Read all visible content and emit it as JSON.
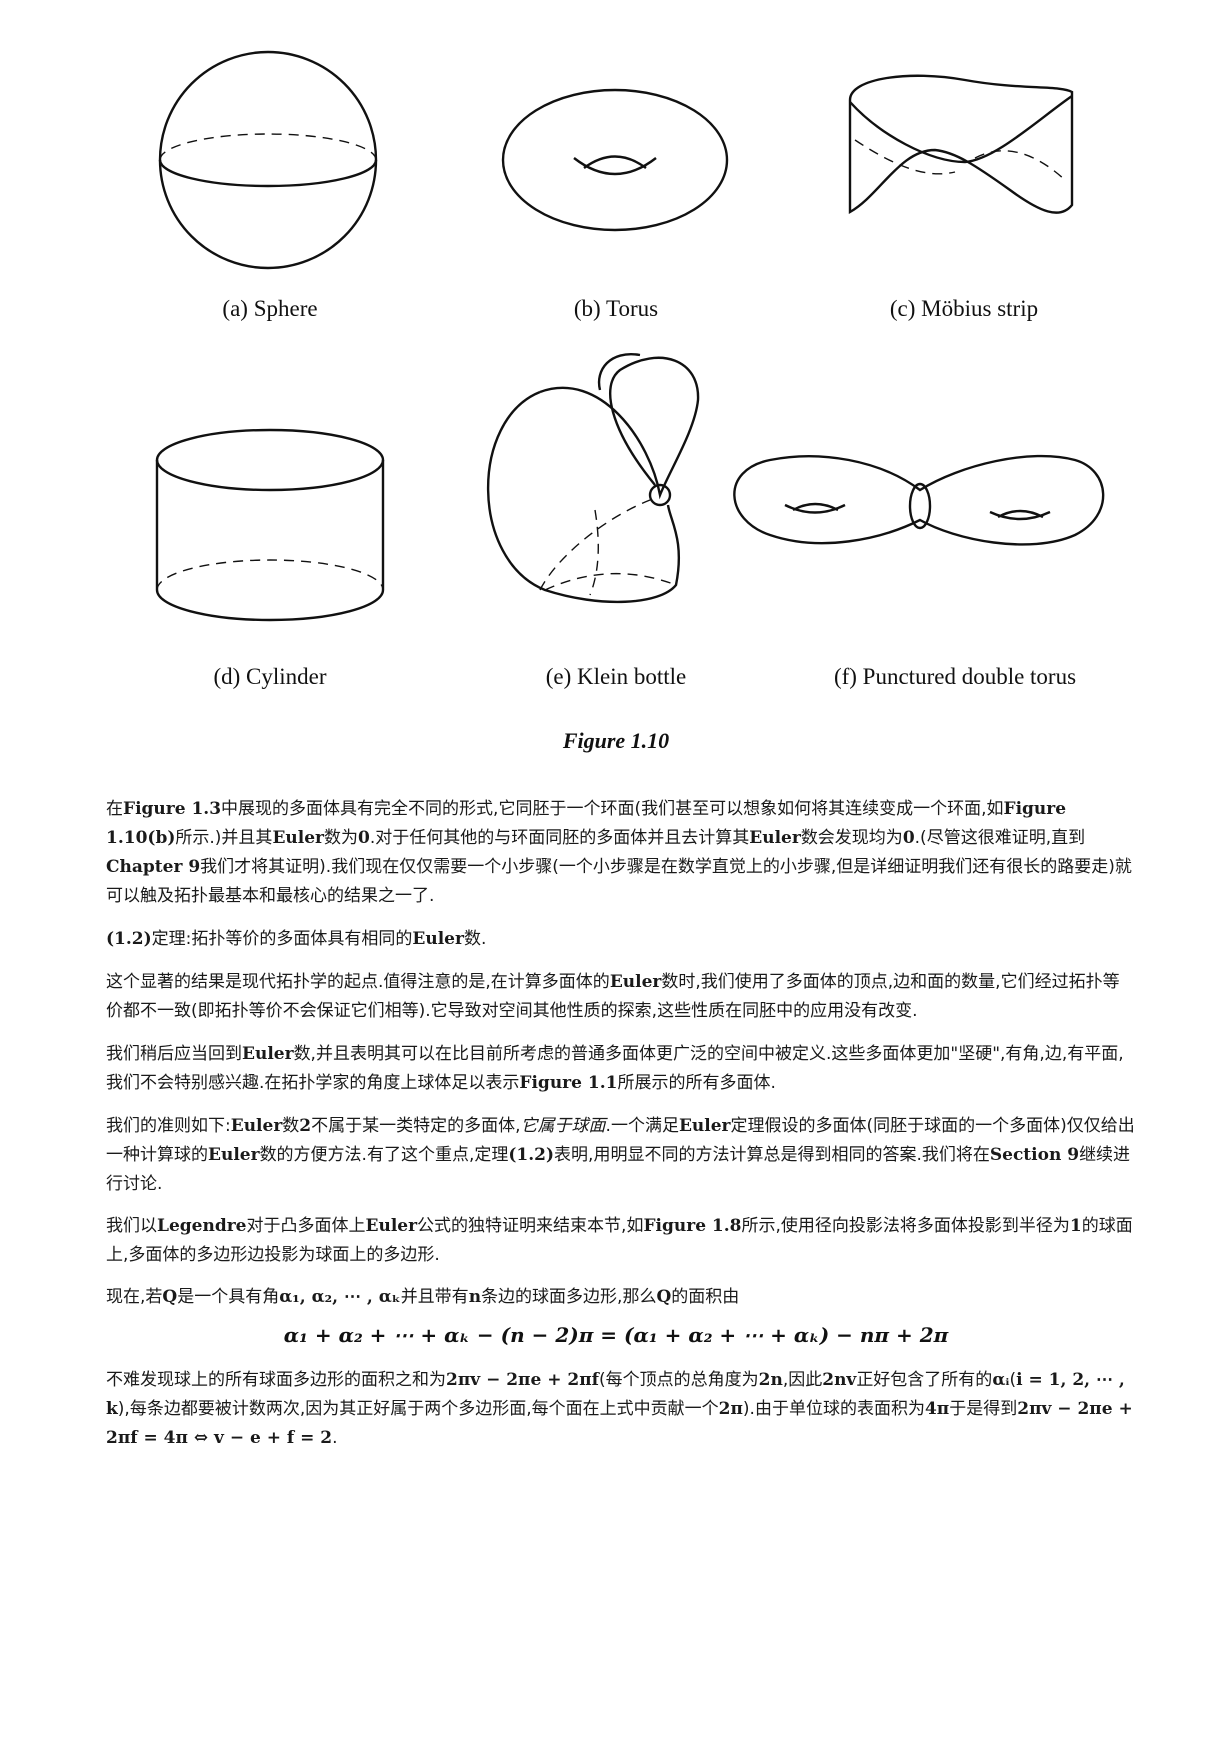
{
  "figure": {
    "captions": {
      "a": "(a) Sphere",
      "b": "(b) Torus",
      "c": "(c) Möbius strip",
      "d": "(d) Cylinder",
      "e": "(e) Klein bottle",
      "f": "(f) Punctured double torus"
    },
    "title": "Figure 1.10"
  },
  "paragraphs": {
    "p1": {
      "a": "在",
      "b": "Figure 1.3",
      "c": "中展现的多面体具有完全不同的形式,它同胚于一个环面(我们甚至可以想象如何将其连续变成一个环面,如",
      "d": "Figure 1.10(b)",
      "e": "所示.)并且其",
      "f": "Euler",
      "g": "数为",
      "h": "0",
      "i": ".对于任何其他的与环面同胚的多面体并且去计算其",
      "j": "Euler",
      "k": "数会发现均为",
      "l": "0",
      "m": ".(尽管这很难证明,直到",
      "n": "Chapter 9",
      "o": "我们才将其证明).我们现在仅仅需要一个小步骤(一个小步骤是在数学直觉上的小步骤,但是详细证明我们还有很长的路要走)就可以触及拓扑最基本和最核心的结果之一了."
    },
    "p2": {
      "a": "(1.2)",
      "b": "定理:拓扑等价的多面体具有相同的",
      "c": "Euler",
      "d": "数."
    },
    "p3": {
      "a": "这个显著的结果是现代拓扑学的起点.值得注意的是,在计算多面体的",
      "b": "Euler",
      "c": "数时,我们使用了多面体的顶点,边和面的数量,它们经过拓扑等价都不一致(即拓扑等价不会保证它们相等).它导致对空间其他性质的探索,这些性质在同胚中的应用没有改变."
    },
    "p4": {
      "a": "我们稍后应当回到",
      "b": "Euler",
      "c": "数,并且表明其可以在比目前所考虑的普通多面体更广泛的空间中被定义.这些多面体更加\"坚硬\",有角,边,有平面,我们不会特别感兴趣.在拓扑学家的角度上球体足以表示",
      "d": "Figure 1.1",
      "e": "所展示的所有多面体."
    },
    "p5": {
      "a": "我们的准则如下:",
      "b": "Euler",
      "c": "数",
      "d": "2",
      "e": "不属于某一类特定的多面体,",
      "f": "它属于球面",
      "g": ".一个满足",
      "h": "Euler",
      "i": "定理假设的多面体(同胚于球面的一个多面体)仅仅给出一种计算球的",
      "j": "Euler",
      "k": "数的方便方法.有了这个重点,定理",
      "l": "(1.2)",
      "m": "表明,用明显不同的方法计算总是得到相同的答案.我们将在",
      "n": "Section 9",
      "o": "继续进行讨论."
    },
    "p6": {
      "a": "我们以",
      "b": "Legendre",
      "c": "对于凸多面体上",
      "d": "Euler",
      "e": "公式的独特证明来结束本节,如",
      "f": "Figure 1.8",
      "g": "所示,使用径向投影法将多面体投影到半径为",
      "h": "1",
      "i": "的球面上,多面体的多边形边投影为球面上的多边形."
    },
    "p7": {
      "a": "现在,若",
      "b": "Q",
      "c": "是一个具有角",
      "d": "α₁, α₂, ⋯ , αₖ",
      "e": "并且带有",
      "f": "n",
      "g": "条边的球面多边形,那么",
      "h": "Q",
      "i": "的面积由"
    },
    "equation": "α₁ + α₂ + ⋯ + αₖ − (n − 2)π = (α₁ + α₂ + ⋯ + αₖ) − nπ + 2π",
    "p8": {
      "a": "不难发现球上的所有球面多边形的面积之和为",
      "b": "2πv − 2πe + 2πf",
      "c": "(每个顶点的总角度为",
      "d": "2n",
      "e": ",因此",
      "f": "2nv",
      "g": "正好包含了所有的",
      "h": "αᵢ",
      "i": "(",
      "j": "i = 1, 2, ⋯ , k",
      "k": "),每条边都要被计数两次,因为其正好属于两个多边形面,每个面在上式中贡献一个",
      "l": "2π",
      "m": ").由于单位球的表面积为",
      "n": "4π",
      "o": "于是得到",
      "p": "2πv − 2πe + 2πf = 4π ⇔ v − e + f = 2",
      "q": "."
    }
  }
}
